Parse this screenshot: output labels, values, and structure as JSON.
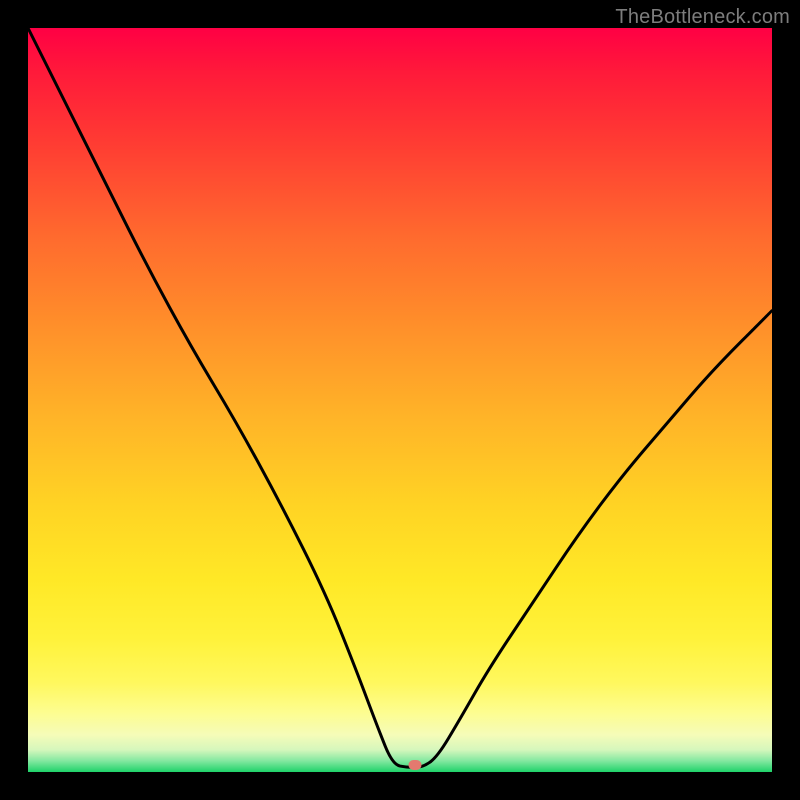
{
  "watermark": "TheBottleneck.com",
  "marker": {
    "x_pct": 52.0,
    "y_pct": 99.0,
    "color": "#e4796f"
  },
  "chart_data": {
    "type": "line",
    "title": "",
    "xlabel": "",
    "ylabel": "",
    "xlim": [
      0,
      100
    ],
    "ylim": [
      0,
      100
    ],
    "grid": false,
    "legend": false,
    "annotations": [
      "TheBottleneck.com"
    ],
    "note": "x and y are percentage positions within the plot area; y = 0 is the bottom (minimum bottleneck), y = 100 is the top.",
    "series": [
      {
        "name": "bottleneck-curve",
        "x": [
          0,
          4,
          10,
          16,
          22,
          28,
          34,
          40,
          44,
          47,
          49,
          51,
          53,
          55,
          58,
          62,
          68,
          74,
          80,
          86,
          92,
          100
        ],
        "y": [
          100,
          92,
          80,
          68,
          57,
          47,
          36,
          24,
          14,
          6,
          1,
          0.6,
          0.6,
          2,
          7,
          14,
          23,
          32,
          40,
          47,
          54,
          62
        ]
      }
    ],
    "background_gradient": {
      "type": "vertical",
      "stops": [
        {
          "pct": 0,
          "color": "#ff0044"
        },
        {
          "pct": 15,
          "color": "#ff3a33"
        },
        {
          "pct": 40,
          "color": "#ff8f2a"
        },
        {
          "pct": 64,
          "color": "#ffd324"
        },
        {
          "pct": 88,
          "color": "#fff85e"
        },
        {
          "pct": 97,
          "color": "#d6f7bc"
        },
        {
          "pct": 100,
          "color": "#1fd26a"
        }
      ]
    }
  }
}
